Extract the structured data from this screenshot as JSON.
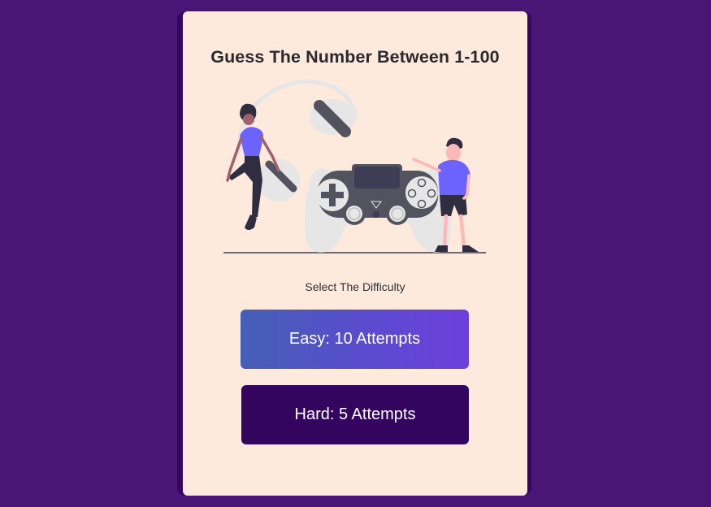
{
  "header": {
    "title": "Guess The Number Between 1-100"
  },
  "illustration": {
    "icon": "gamers-with-controller-illustration"
  },
  "difficulty": {
    "prompt": "Select The Difficulty",
    "options": [
      {
        "label": "Easy: 10 Attempts"
      },
      {
        "label": "Hard: 5 Attempts"
      }
    ]
  },
  "colors": {
    "background": "#4a1675",
    "card": "#fee9dd",
    "card_shadow": "#35055f",
    "easy_gradient_start": "#4460b5",
    "easy_gradient_end": "#6d3fdd",
    "hard_button": "#34055e",
    "accent_purple": "#6c63ff"
  }
}
